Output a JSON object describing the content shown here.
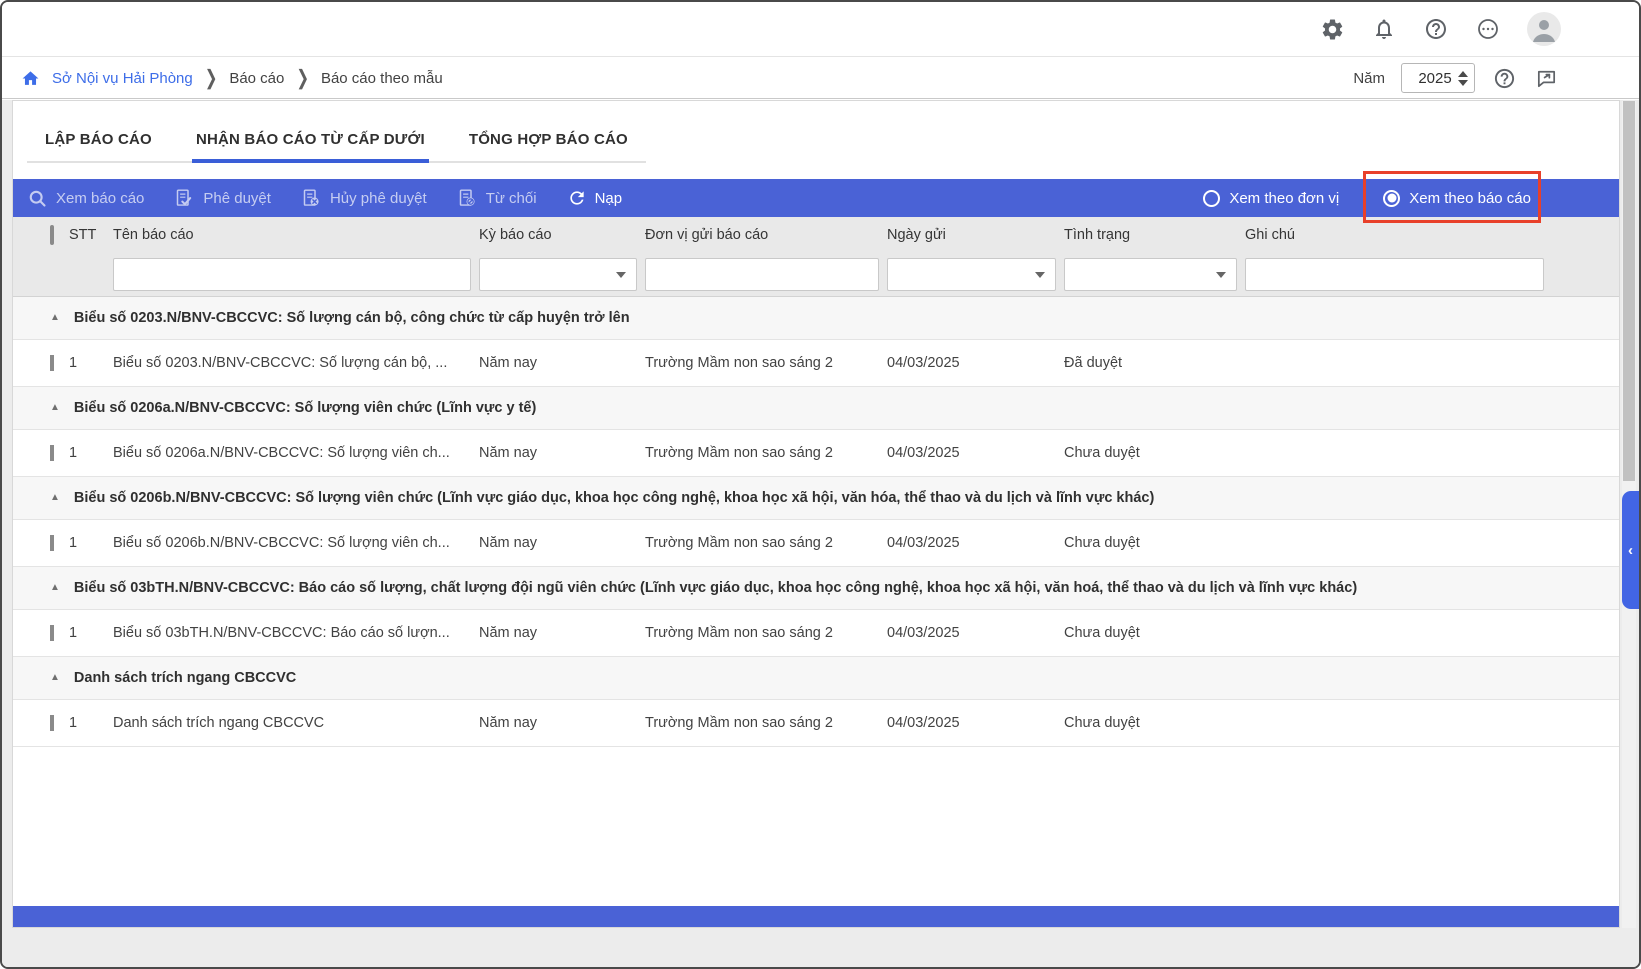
{
  "topbar": {
    "icons": [
      "settings",
      "notifications",
      "help",
      "more",
      "avatar"
    ]
  },
  "breadcrumb": {
    "home": "Sở Nội vụ Hải Phòng",
    "items": [
      "Báo cáo",
      "Báo cáo theo mẫu"
    ],
    "year_label": "Năm",
    "year_value": "2025"
  },
  "tabs": [
    {
      "label": "LẬP BÁO CÁO",
      "active": false
    },
    {
      "label": "NHẬN BÁO CÁO TỪ CẤP DƯỚI",
      "active": true
    },
    {
      "label": "TỔNG HỢP BÁO CÁO",
      "active": false
    }
  ],
  "toolbar": {
    "buttons": [
      {
        "label": "Xem báo cáo",
        "icon": "search-icon",
        "enabled": false
      },
      {
        "label": "Phê duyệt",
        "icon": "document-approve-icon",
        "enabled": false
      },
      {
        "label": "Hủy phê duyệt",
        "icon": "document-cancel-approve-icon",
        "enabled": false
      },
      {
        "label": "Từ chối",
        "icon": "document-reject-icon",
        "enabled": false
      },
      {
        "label": "Nạp",
        "icon": "refresh-icon",
        "enabled": true
      }
    ],
    "view_options": [
      {
        "label": "Xem theo đơn vị",
        "selected": false
      },
      {
        "label": "Xem theo báo cáo",
        "selected": true,
        "highlighted": true
      }
    ],
    "highlight_color": "#e8402a",
    "bar_color": "#4a62d6"
  },
  "table": {
    "columns": [
      "STT",
      "Tên báo cáo",
      "Kỳ báo cáo",
      "Đơn vị gửi báo cáo",
      "Ngày gửi",
      "Tình trạng",
      "Ghi chú"
    ],
    "filters": [
      {
        "column": "Tên báo cáo",
        "type": "text",
        "value": ""
      },
      {
        "column": "Kỳ báo cáo",
        "type": "select",
        "value": ""
      },
      {
        "column": "Đơn vị gửi báo cáo",
        "type": "text",
        "value": ""
      },
      {
        "column": "Ngày gửi",
        "type": "select",
        "value": ""
      },
      {
        "column": "Tình trạng",
        "type": "select",
        "value": ""
      },
      {
        "column": "Ghi chú",
        "type": "text",
        "value": ""
      }
    ],
    "groups": [
      {
        "title": "Biểu số 0203.N/BNV-CBCCVC: Số lượng cán bộ, công chức từ cấp huyện trở lên",
        "rows": [
          {
            "stt": "1",
            "name": "Biểu số 0203.N/BNV-CBCCVC: Số lượng cán bộ, ...",
            "period": "Năm nay",
            "unit": "Trường Mầm non sao sáng 2",
            "date": "04/03/2025",
            "status": "Đã duyệt",
            "note": ""
          }
        ]
      },
      {
        "title": "Biểu số 0206a.N/BNV-CBCCVC: Số lượng viên chức (Lĩnh vực y tế)",
        "rows": [
          {
            "stt": "1",
            "name": "Biểu số 0206a.N/BNV-CBCCVC: Số lượng viên ch...",
            "period": "Năm nay",
            "unit": "Trường Mầm non sao sáng 2",
            "date": "04/03/2025",
            "status": "Chưa duyệt",
            "note": ""
          }
        ]
      },
      {
        "title": "Biểu số 0206b.N/BNV-CBCCVC: Số lượng viên chức (Lĩnh vực giáo dục, khoa học công nghệ, khoa học xã hội, văn hóa, thể thao và du lịch và lĩnh vực khác)",
        "rows": [
          {
            "stt": "1",
            "name": "Biểu số 0206b.N/BNV-CBCCVC: Số lượng viên ch...",
            "period": "Năm nay",
            "unit": "Trường Mầm non sao sáng 2",
            "date": "04/03/2025",
            "status": "Chưa duyệt",
            "note": ""
          }
        ]
      },
      {
        "title": "Biểu số 03bTH.N/BNV-CBCCVC: Báo cáo số lượng, chất lượng đội ngũ viên chức (Lĩnh vực giáo dục, khoa học công nghệ, khoa học xã hội, văn hoá, thể thao và du lịch và lĩnh vực khác)",
        "rows": [
          {
            "stt": "1",
            "name": "Biểu số 03bTH.N/BNV-CBCCVC: Báo cáo số lượn...",
            "period": "Năm nay",
            "unit": "Trường Mầm non sao sáng 2",
            "date": "04/03/2025",
            "status": "Chưa duyệt",
            "note": ""
          }
        ]
      },
      {
        "title": "Danh sách trích ngang CBCCVC",
        "rows": [
          {
            "stt": "1",
            "name": "Danh sách trích ngang CBCCVC",
            "period": "Năm nay",
            "unit": "Trường Mầm non sao sáng 2",
            "date": "04/03/2025",
            "status": "Chưa duyệt",
            "note": ""
          }
        ]
      }
    ]
  },
  "side_tab": {
    "chevron": "‹"
  },
  "colors": {
    "toolbar_blue": "#4a62d6",
    "link_blue": "#3d6de8",
    "tab_underline": "#3a5ed8",
    "highlight_red": "#e8402a"
  }
}
